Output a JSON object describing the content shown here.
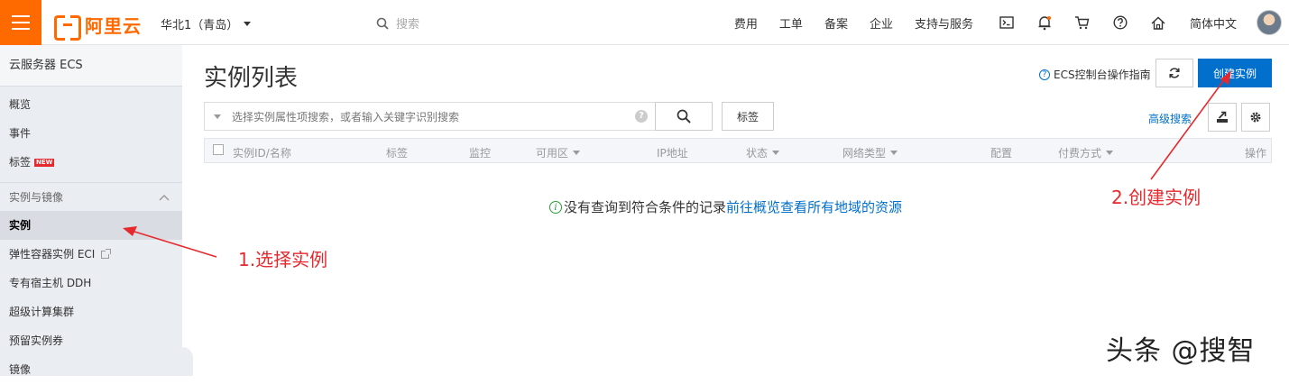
{
  "brand": {
    "logo_text": "阿里云",
    "accent": "#ff6a00",
    "primary": "#0070cc"
  },
  "header": {
    "region": "华北1（青岛）",
    "search_placeholder": "搜索",
    "nav": [
      "费用",
      "工单",
      "备案",
      "企业",
      "支持与服务"
    ],
    "icons": [
      "terminal-icon",
      "bell-icon",
      "cart-icon",
      "help-icon",
      "home-icon"
    ],
    "language": "简体中文"
  },
  "sidebar": {
    "title": "云服务器 ECS",
    "top_items": [
      "概览",
      "事件",
      "标签"
    ],
    "new_badge": "NEW",
    "group": "实例与镜像",
    "group_items": [
      "实例",
      "弹性容器实例 ECI",
      "专有宿主机 DDH",
      "超级计算集群",
      "预留实例券",
      "镜像"
    ]
  },
  "main": {
    "title": "实例列表",
    "help_link": "ECS控制台操作指南",
    "create_button": "创建实例",
    "search_placeholder": "选择实例属性项搜索，或者输入关键字识别搜索",
    "tag_button": "标签",
    "advanced_search": "高级搜索",
    "columns": [
      "实例ID/名称",
      "标签",
      "监控",
      "可用区",
      "IP地址",
      "状态",
      "网络类型",
      "配置",
      "付费方式",
      "操作"
    ],
    "empty_text": "没有查询到符合条件的记录",
    "empty_link": "前往概览查看所有地域的资源"
  },
  "annotations": {
    "step1": "1.选择实例",
    "step2": "2.创建实例",
    "color": "#e5292e"
  },
  "watermark": "头条 @搜智"
}
